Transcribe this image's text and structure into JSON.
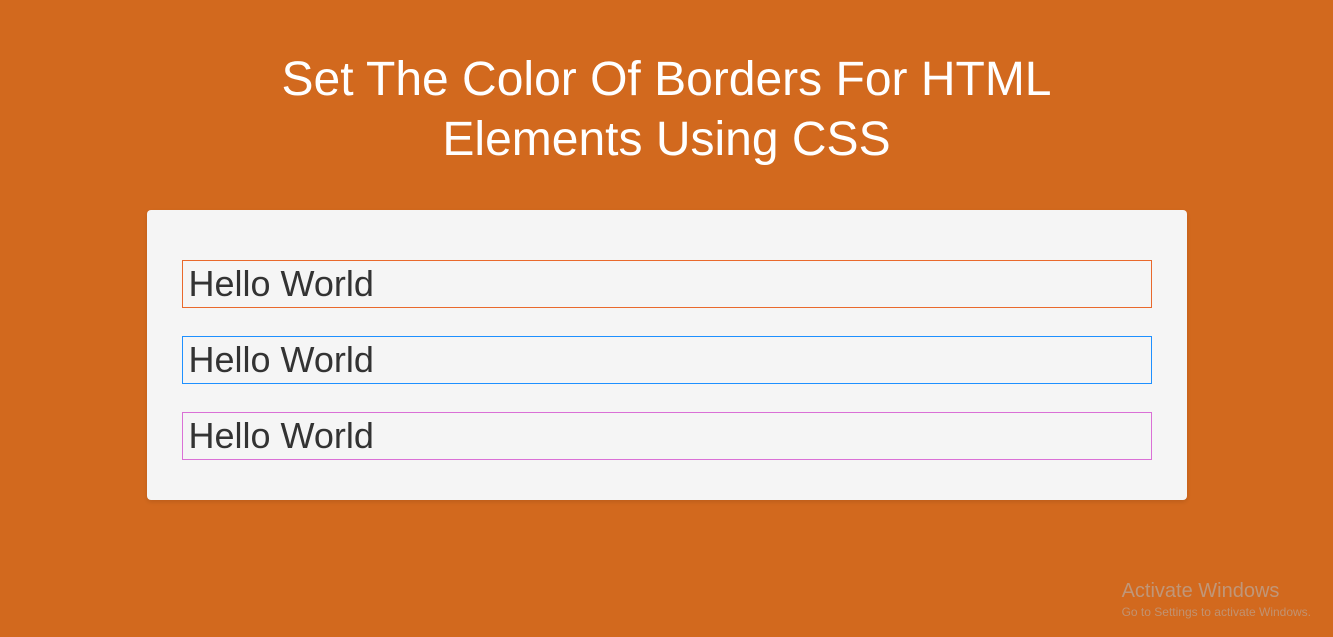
{
  "header": {
    "title": "Set The Color Of Borders For HTML Elements Using CSS"
  },
  "card": {
    "items": [
      {
        "text": "Hello World",
        "border_color": "#e9692c"
      },
      {
        "text": "Hello World",
        "border_color": "#1e90ff"
      },
      {
        "text": "Hello World",
        "border_color": "#da70d6"
      }
    ]
  },
  "watermark": {
    "title": "Activate Windows",
    "subtitle": "Go to Settings to activate Windows."
  }
}
